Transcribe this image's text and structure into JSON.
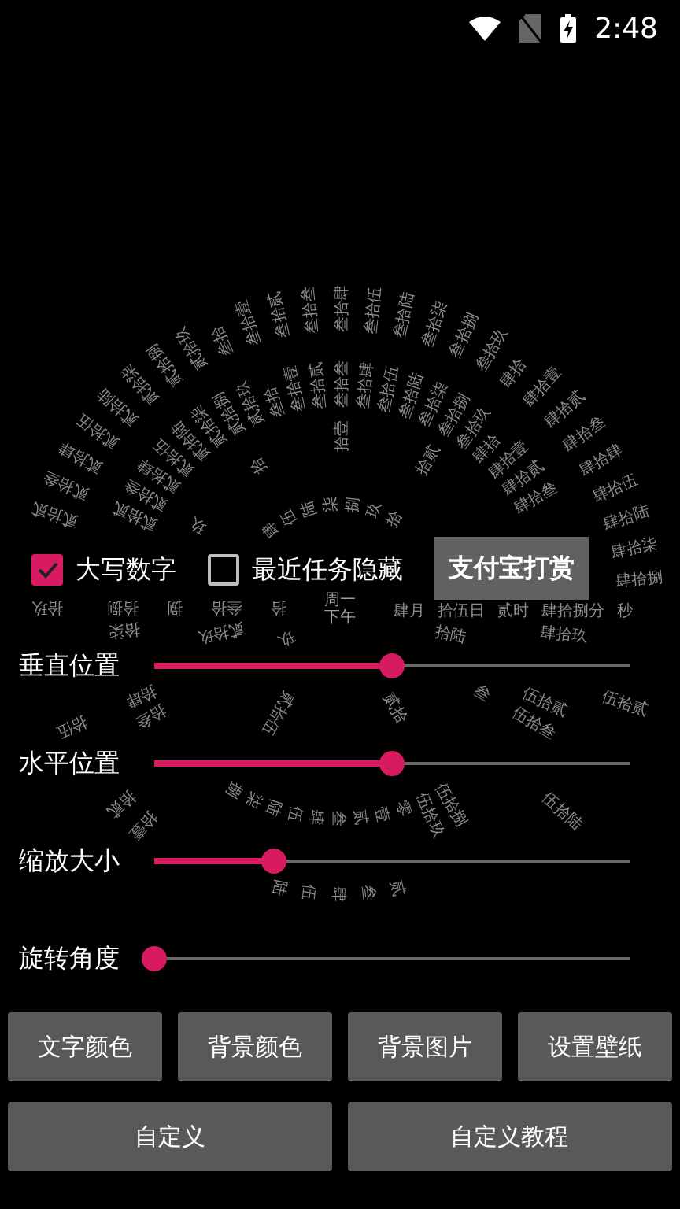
{
  "status_bar": {
    "time": "2:48"
  },
  "clock": {
    "center": [
      "周一",
      "下午"
    ],
    "rings": [
      {
        "kind": "month",
        "slots": [
          {
            "kind": "label",
            "text": "肆月"
          },
          {
            "kind": "gap"
          },
          {
            "kind": "gap"
          },
          {
            "kind": "gap"
          },
          {
            "kind": "gap"
          },
          {
            "kind": "label",
            "text": "玖"
          },
          {
            "kind": "label",
            "text": "拾"
          },
          {
            "kind": "gap"
          },
          {
            "kind": "gap"
          },
          {
            "kind": "gap"
          },
          {
            "kind": "gap"
          },
          {
            "kind": "gap"
          }
        ]
      },
      {
        "kind": "day",
        "slots": [
          {
            "kind": "label",
            "text": "拾伍日"
          },
          {
            "kind": "label",
            "text": "拾陆"
          },
          {
            "kind": "gap"
          },
          {
            "kind": "gap"
          },
          {
            "kind": "gap"
          },
          {
            "kind": "label",
            "text": "贰拾"
          },
          {
            "kind": "gap"
          },
          {
            "kind": "gap"
          },
          {
            "kind": "gap"
          },
          {
            "kind": "gap"
          },
          {
            "kind": "label",
            "text": "贰拾伍"
          },
          {
            "kind": "gap"
          },
          {
            "kind": "gap"
          },
          {
            "kind": "gap"
          },
          {
            "kind": "label",
            "text": "贰拾玖"
          },
          {
            "kind": "label",
            "text": "叁拾"
          },
          {
            "kind": "gap"
          },
          {
            "kind": "gap"
          },
          {
            "kind": "gap"
          },
          {
            "kind": "label",
            "text": "肆"
          },
          {
            "kind": "label",
            "text": "伍"
          },
          {
            "kind": "label",
            "text": "陆"
          },
          {
            "kind": "label",
            "text": "柒"
          },
          {
            "kind": "label",
            "text": "捌"
          },
          {
            "kind": "label",
            "text": "玖"
          },
          {
            "kind": "label",
            "text": "拾"
          },
          {
            "kind": "gap"
          },
          {
            "kind": "gap"
          },
          {
            "kind": "gap"
          },
          {
            "kind": "gap"
          }
        ]
      },
      {
        "kind": "hour",
        "slots": [
          {
            "kind": "label",
            "text": "贰时"
          },
          {
            "kind": "label",
            "text": "叁"
          },
          {
            "kind": "gap"
          },
          {
            "kind": "gap"
          },
          {
            "kind": "gap"
          },
          {
            "kind": "gap"
          },
          {
            "kind": "label",
            "text": "捌"
          },
          {
            "kind": "label",
            "text": "玖"
          },
          {
            "kind": "label",
            "text": "拾"
          },
          {
            "kind": "label",
            "text": "拾壹"
          },
          {
            "kind": "label",
            "text": "拾贰"
          },
          {
            "kind": "gap"
          }
        ]
      },
      {
        "kind": "minute",
        "slots": [
          {
            "kind": "label",
            "text": "肆拾捌分"
          },
          {
            "kind": "label",
            "text": "肆拾玖"
          },
          {
            "kind": "gap"
          },
          {
            "kind": "gap"
          },
          {
            "kind": "label",
            "text": "伍拾贰"
          },
          {
            "kind": "label",
            "text": "伍拾叁"
          },
          {
            "kind": "gap"
          },
          {
            "kind": "gap"
          },
          {
            "kind": "gap"
          },
          {
            "kind": "gap"
          },
          {
            "kind": "label",
            "text": "伍拾捌"
          },
          {
            "kind": "label",
            "text": "伍拾玖"
          },
          {
            "kind": "label",
            "text": "零"
          },
          {
            "kind": "label",
            "text": "壹"
          },
          {
            "kind": "label",
            "text": "贰"
          },
          {
            "kind": "label",
            "text": "叁"
          },
          {
            "kind": "label",
            "text": "肆"
          },
          {
            "kind": "label",
            "text": "伍"
          },
          {
            "kind": "label",
            "text": "陆"
          },
          {
            "kind": "label",
            "text": "柒"
          },
          {
            "kind": "label",
            "text": "捌"
          },
          {
            "kind": "gap"
          },
          {
            "kind": "gap"
          },
          {
            "kind": "gap"
          },
          {
            "kind": "gap"
          },
          {
            "kind": "label",
            "text": "拾叁"
          },
          {
            "kind": "label",
            "text": "拾肆"
          },
          {
            "kind": "gap"
          },
          {
            "kind": "gap"
          },
          {
            "kind": "label",
            "text": "拾柒"
          },
          {
            "kind": "label",
            "text": "拾捌"
          },
          {
            "kind": "gap"
          },
          {
            "kind": "gap"
          },
          {
            "kind": "gap"
          },
          {
            "kind": "label",
            "text": "贰拾贰"
          },
          {
            "kind": "label",
            "text": "贰拾叁"
          },
          {
            "kind": "label",
            "text": "贰拾肆"
          },
          {
            "kind": "label",
            "text": "贰拾伍"
          },
          {
            "kind": "label",
            "text": "贰拾陆"
          },
          {
            "kind": "label",
            "text": "贰拾柒"
          },
          {
            "kind": "label",
            "text": "贰拾捌"
          },
          {
            "kind": "label",
            "text": "贰拾玖"
          },
          {
            "kind": "label",
            "text": "叁拾"
          },
          {
            "kind": "label",
            "text": "叁拾壹"
          },
          {
            "kind": "label",
            "text": "叁拾贰"
          },
          {
            "kind": "label",
            "text": "叁拾叁"
          },
          {
            "kind": "label",
            "text": "叁拾肆"
          },
          {
            "kind": "label",
            "text": "叁拾伍"
          },
          {
            "kind": "label",
            "text": "叁拾陆"
          },
          {
            "kind": "label",
            "text": "叁拾柒"
          },
          {
            "kind": "label",
            "text": "叁拾捌"
          },
          {
            "kind": "label",
            "text": "叁拾玖"
          },
          {
            "kind": "label",
            "text": "肆拾"
          },
          {
            "kind": "label",
            "text": "肆拾壹"
          },
          {
            "kind": "label",
            "text": "肆拾贰"
          },
          {
            "kind": "label",
            "text": "肆拾叁"
          },
          {
            "kind": "gap"
          },
          {
            "kind": "gap"
          },
          {
            "kind": "gap"
          },
          {
            "kind": "gap"
          }
        ]
      },
      {
        "kind": "second",
        "slots": [
          {
            "kind": "label",
            "text": "秒"
          },
          {
            "kind": "gap"
          },
          {
            "kind": "gap"
          },
          {
            "kind": "label",
            "text": "伍拾贰"
          },
          {
            "kind": "gap"
          },
          {
            "kind": "gap"
          },
          {
            "kind": "gap"
          },
          {
            "kind": "label",
            "text": "伍拾陆"
          },
          {
            "kind": "gap"
          },
          {
            "kind": "gap"
          },
          {
            "kind": "gap"
          },
          {
            "kind": "gap"
          },
          {
            "kind": "gap"
          },
          {
            "kind": "label",
            "text": "贰"
          },
          {
            "kind": "label",
            "text": "叁"
          },
          {
            "kind": "label",
            "text": "肆"
          },
          {
            "kind": "label",
            "text": "伍"
          },
          {
            "kind": "label",
            "text": "陆"
          },
          {
            "kind": "gap"
          },
          {
            "kind": "gap"
          },
          {
            "kind": "gap"
          },
          {
            "kind": "gap"
          },
          {
            "kind": "label",
            "text": "拾壹"
          },
          {
            "kind": "label",
            "text": "拾贰"
          },
          {
            "kind": "gap"
          },
          {
            "kind": "gap"
          },
          {
            "kind": "label",
            "text": "拾伍"
          },
          {
            "kind": "gap"
          },
          {
            "kind": "gap"
          },
          {
            "kind": "gap"
          },
          {
            "kind": "label",
            "text": "拾玖"
          },
          {
            "kind": "gap"
          },
          {
            "kind": "gap"
          },
          {
            "kind": "label",
            "text": "贰拾贰"
          },
          {
            "kind": "label",
            "text": "贰拾叁"
          },
          {
            "kind": "label",
            "text": "贰拾肆"
          },
          {
            "kind": "label",
            "text": "贰拾伍"
          },
          {
            "kind": "label",
            "text": "贰拾陆"
          },
          {
            "kind": "label",
            "text": "贰拾柒"
          },
          {
            "kind": "label",
            "text": "贰拾捌"
          },
          {
            "kind": "label",
            "text": "贰拾玖"
          },
          {
            "kind": "label",
            "text": "叁拾"
          },
          {
            "kind": "label",
            "text": "叁拾壹"
          },
          {
            "kind": "label",
            "text": "叁拾贰"
          },
          {
            "kind": "label",
            "text": "叁拾叁"
          },
          {
            "kind": "label",
            "text": "叁拾肆"
          },
          {
            "kind": "label",
            "text": "叁拾伍"
          },
          {
            "kind": "label",
            "text": "叁拾陆"
          },
          {
            "kind": "label",
            "text": "叁拾柒"
          },
          {
            "kind": "label",
            "text": "叁拾捌"
          },
          {
            "kind": "label",
            "text": "叁拾玖"
          },
          {
            "kind": "label",
            "text": "肆拾"
          },
          {
            "kind": "label",
            "text": "肆拾壹"
          },
          {
            "kind": "label",
            "text": "肆拾贰"
          },
          {
            "kind": "label",
            "text": "肆拾叁"
          },
          {
            "kind": "label",
            "text": "肆拾肆"
          },
          {
            "kind": "label",
            "text": "肆拾伍"
          },
          {
            "kind": "label",
            "text": "肆拾陆"
          },
          {
            "kind": "label",
            "text": "肆拾柒"
          },
          {
            "kind": "label",
            "text": "肆拾捌"
          }
        ]
      }
    ]
  },
  "options": [
    {
      "label": "大写数字",
      "checked": true
    },
    {
      "label": "最近任务隐藏",
      "checked": false
    }
  ],
  "tip_button": "支付宝打赏",
  "sliders": [
    {
      "label": "垂直位置",
      "level": 0.5
    },
    {
      "label": "水平位置",
      "level": 0.5
    },
    {
      "label": "缩放大小",
      "level": 0.25
    },
    {
      "label": "旋转角度",
      "level": 0
    }
  ],
  "buttons": [
    "文字颜色",
    "背景颜色",
    "背景图片",
    "设置壁纸"
  ],
  "wide_buttons": [
    "自定义",
    "自定义教程"
  ]
}
